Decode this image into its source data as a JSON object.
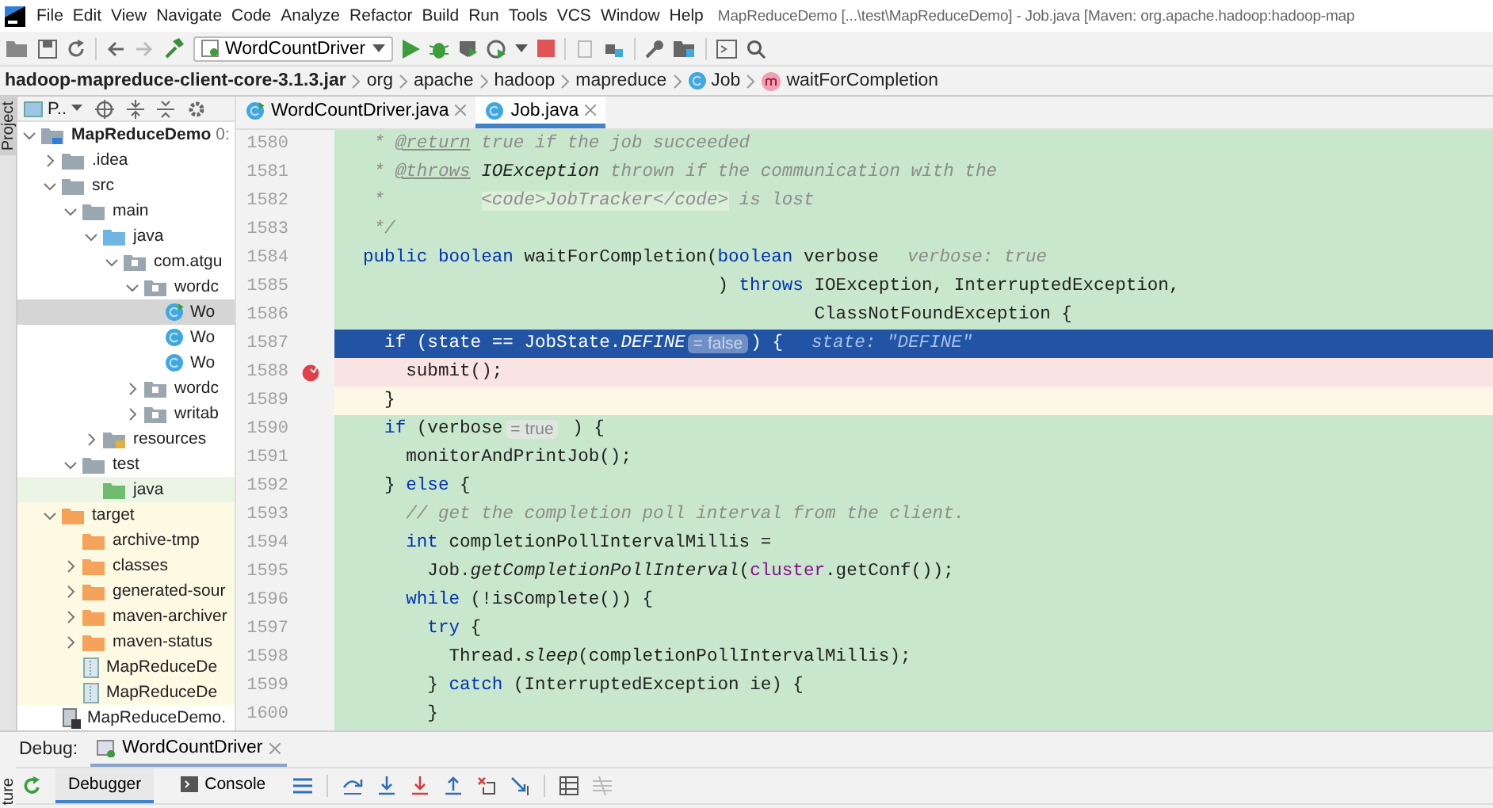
{
  "menu": [
    "File",
    "Edit",
    "View",
    "Navigate",
    "Code",
    "Analyze",
    "Refactor",
    "Build",
    "Run",
    "Tools",
    "VCS",
    "Window",
    "Help"
  ],
  "window": {
    "title": "MapReduceDemo [...\\test\\MapReduceDemo] - Job.java [Maven: org.apache.hadoop:hadoop-map"
  },
  "toolbar": {
    "run_config": "WordCountDriver"
  },
  "breadcrumbs": [
    {
      "label": "hadoop-mapreduce-client-core-3.1.3.jar",
      "kind": "jar"
    },
    {
      "label": "org",
      "kind": "package"
    },
    {
      "label": "apache",
      "kind": "package"
    },
    {
      "label": "hadoop",
      "kind": "package"
    },
    {
      "label": "mapreduce",
      "kind": "package"
    },
    {
      "label": "Job",
      "kind": "class"
    },
    {
      "label": "waitForCompletion",
      "kind": "method"
    }
  ],
  "side_stripe": {
    "top": "Project",
    "bottom": "ture"
  },
  "project": {
    "view": "P..",
    "tree": [
      {
        "name": "MapReduceDemo",
        "hint": "0:",
        "kind": "module",
        "expanded": true,
        "selected": false,
        "children": [
          {
            "name": ".idea",
            "kind": "folder",
            "expanded": false,
            "selected": false
          },
          {
            "name": "src",
            "kind": "folder",
            "expanded": true,
            "selected": false,
            "children": [
              {
                "name": "main",
                "kind": "folder",
                "expanded": true,
                "selected": false,
                "children": [
                  {
                    "name": "java",
                    "kind": "source-root",
                    "expanded": true,
                    "selected": false,
                    "children": [
                      {
                        "name": "com.atgu",
                        "kind": "package",
                        "expanded": true,
                        "selected": false,
                        "children": [
                          {
                            "name": "wordc",
                            "kind": "package",
                            "expanded": true,
                            "selected": false,
                            "children": [
                              {
                                "name": "Wo",
                                "kind": "class-main",
                                "selected": true
                              },
                              {
                                "name": "Wo",
                                "kind": "class",
                                "selected": false
                              },
                              {
                                "name": "Wo",
                                "kind": "class",
                                "selected": false
                              }
                            ]
                          },
                          {
                            "name": "wordc",
                            "kind": "package",
                            "expanded": false,
                            "selected": false
                          },
                          {
                            "name": "writab",
                            "kind": "package",
                            "expanded": false,
                            "selected": false
                          }
                        ]
                      }
                    ]
                  },
                  {
                    "name": "resources",
                    "kind": "resources-root",
                    "expanded": false,
                    "selected": false
                  }
                ]
              },
              {
                "name": "test",
                "kind": "folder",
                "expanded": true,
                "selected": false,
                "children": [
                  {
                    "name": "java",
                    "kind": "test-root",
                    "selected": false
                  }
                ]
              }
            ]
          },
          {
            "name": "target",
            "kind": "excluded",
            "expanded": true,
            "selected": false,
            "children": [
              {
                "name": "archive-tmp",
                "kind": "excluded",
                "selected": false
              },
              {
                "name": "classes",
                "kind": "excluded",
                "expanded": false,
                "selected": false
              },
              {
                "name": "generated-sour",
                "kind": "excluded",
                "expanded": false,
                "selected": false
              },
              {
                "name": "maven-archiver",
                "kind": "excluded",
                "expanded": false,
                "selected": false
              },
              {
                "name": "maven-status",
                "kind": "excluded",
                "expanded": false,
                "selected": false
              },
              {
                "name": "MapReduceDe",
                "kind": "excluded-file",
                "selected": false
              },
              {
                "name": "MapReduceDe",
                "kind": "excluded-file",
                "selected": false
              }
            ]
          },
          {
            "name": "MapReduceDemo.",
            "kind": "module-file",
            "selected": false
          }
        ]
      }
    ]
  },
  "editor_tabs": [
    {
      "label": "WordCountDriver.java",
      "kind": "class-main",
      "selected": false
    },
    {
      "label": "Job.java",
      "kind": "class-lib",
      "selected": true
    }
  ],
  "code": [
    {
      "number": "1580",
      "kind": "plain",
      "tokens": [
        {
          "text": " * ",
          "kind": "comment"
        },
        {
          "text": "@return",
          "kind": "doctag"
        },
        {
          "text": " true if the job succeeded",
          "kind": "comment"
        }
      ]
    },
    {
      "number": "1581",
      "kind": "plain",
      "tokens": [
        {
          "text": " * ",
          "kind": "comment"
        },
        {
          "text": "@throws",
          "kind": "doctag"
        },
        {
          "text": " IOException",
          "kind": "docref"
        },
        {
          "text": " thrown if the communication with the",
          "kind": "comment"
        }
      ]
    },
    {
      "number": "1582",
      "kind": "plain",
      "tokens": [
        {
          "text": " *         ",
          "kind": "comment"
        },
        {
          "text": "<code>JobTracker</code>",
          "kind": "doccode"
        },
        {
          "text": " is lost",
          "kind": "comment"
        }
      ]
    },
    {
      "number": "1583",
      "kind": "plain",
      "tokens": [
        {
          "text": " */",
          "kind": "comment"
        }
      ]
    },
    {
      "number": "1584",
      "kind": "plain",
      "tokens": [
        {
          "text": "public boolean",
          "kind": "kw"
        },
        {
          "text": " waitForCompletion(",
          "kind": "plain"
        },
        {
          "text": "boolean",
          "kind": "kw"
        },
        {
          "text": " verbose",
          "kind": "plain"
        },
        {
          "text": "verbose: true",
          "kind": "value"
        }
      ]
    },
    {
      "number": "1585",
      "kind": "plain",
      "tokens": [
        {
          "text": "                                 ) ",
          "kind": "plain"
        },
        {
          "text": "throws",
          "kind": "kw"
        },
        {
          "text": " IOException, InterruptedException,",
          "kind": "plain"
        }
      ]
    },
    {
      "number": "1586",
      "kind": "plain",
      "tokens": [
        {
          "text": "                                          ClassNotFoundException {",
          "kind": "plain"
        }
      ]
    },
    {
      "number": "1587",
      "kind": "execution",
      "tokens": [
        {
          "text": "  if",
          "kind": "kw"
        },
        {
          "text": " (state == JobState.",
          "kind": "plain"
        },
        {
          "text": "DEFINE",
          "kind": "italic"
        },
        {
          "text": "= false",
          "kind": "hint"
        },
        {
          "text": ") {",
          "kind": "plain"
        },
        {
          "text": "state: \"DEFINE\"",
          "kind": "value"
        }
      ]
    },
    {
      "number": "1588",
      "kind": "breakpoint",
      "breakpoint": true,
      "tokens": [
        {
          "text": "    submit();",
          "kind": "plain"
        }
      ]
    },
    {
      "number": "1589",
      "kind": "caret",
      "tokens": [
        {
          "text": "  }",
          "kind": "plain"
        }
      ]
    },
    {
      "number": "1590",
      "kind": "plain",
      "tokens": [
        {
          "text": "  if",
          "kind": "kw"
        },
        {
          "text": " (verbose",
          "kind": "plain"
        },
        {
          "text": "= true",
          "kind": "hint"
        },
        {
          "text": " ) {",
          "kind": "plain"
        }
      ]
    },
    {
      "number": "1591",
      "kind": "plain",
      "tokens": [
        {
          "text": "    monitorAndPrintJob();",
          "kind": "plain"
        }
      ]
    },
    {
      "number": "1592",
      "kind": "plain",
      "tokens": [
        {
          "text": "  } ",
          "kind": "plain"
        },
        {
          "text": "else",
          "kind": "kw"
        },
        {
          "text": " {",
          "kind": "plain"
        }
      ]
    },
    {
      "number": "1593",
      "kind": "plain",
      "tokens": [
        {
          "text": "    // get the completion poll interval from the client.",
          "kind": "comment"
        }
      ]
    },
    {
      "number": "1594",
      "kind": "plain",
      "tokens": [
        {
          "text": "    int",
          "kind": "kw"
        },
        {
          "text": " completionPollIntervalMillis =",
          "kind": "plain"
        }
      ]
    },
    {
      "number": "1595",
      "kind": "plain",
      "tokens": [
        {
          "text": "      Job.",
          "kind": "plain"
        },
        {
          "text": "getCompletionPollInterval",
          "kind": "italic"
        },
        {
          "text": "(",
          "kind": "plain"
        },
        {
          "text": "cluster",
          "kind": "field"
        },
        {
          "text": ".getConf());",
          "kind": "plain"
        }
      ]
    },
    {
      "number": "1596",
      "kind": "plain",
      "tokens": [
        {
          "text": "    while",
          "kind": "kw"
        },
        {
          "text": " (!isComplete()) {",
          "kind": "plain"
        }
      ]
    },
    {
      "number": "1597",
      "kind": "plain",
      "tokens": [
        {
          "text": "      try",
          "kind": "kw"
        },
        {
          "text": " {",
          "kind": "plain"
        }
      ]
    },
    {
      "number": "1598",
      "kind": "plain",
      "tokens": [
        {
          "text": "        Thread.",
          "kind": "plain"
        },
        {
          "text": "sleep",
          "kind": "italic"
        },
        {
          "text": "(completionPollIntervalMillis);",
          "kind": "plain"
        }
      ]
    },
    {
      "number": "1599",
      "kind": "plain",
      "tokens": [
        {
          "text": "      } ",
          "kind": "plain"
        },
        {
          "text": "catch",
          "kind": "kw"
        },
        {
          "text": " (InterruptedException ie) {",
          "kind": "plain"
        }
      ]
    },
    {
      "number": "1600",
      "kind": "plain",
      "tokens": [
        {
          "text": "      }",
          "kind": "plain"
        }
      ]
    }
  ],
  "debug": {
    "label": "Debug:",
    "session": "WordCountDriver",
    "tabs": [
      {
        "label": "Debugger",
        "selected": true
      },
      {
        "label": "Console",
        "selected": false
      }
    ]
  }
}
